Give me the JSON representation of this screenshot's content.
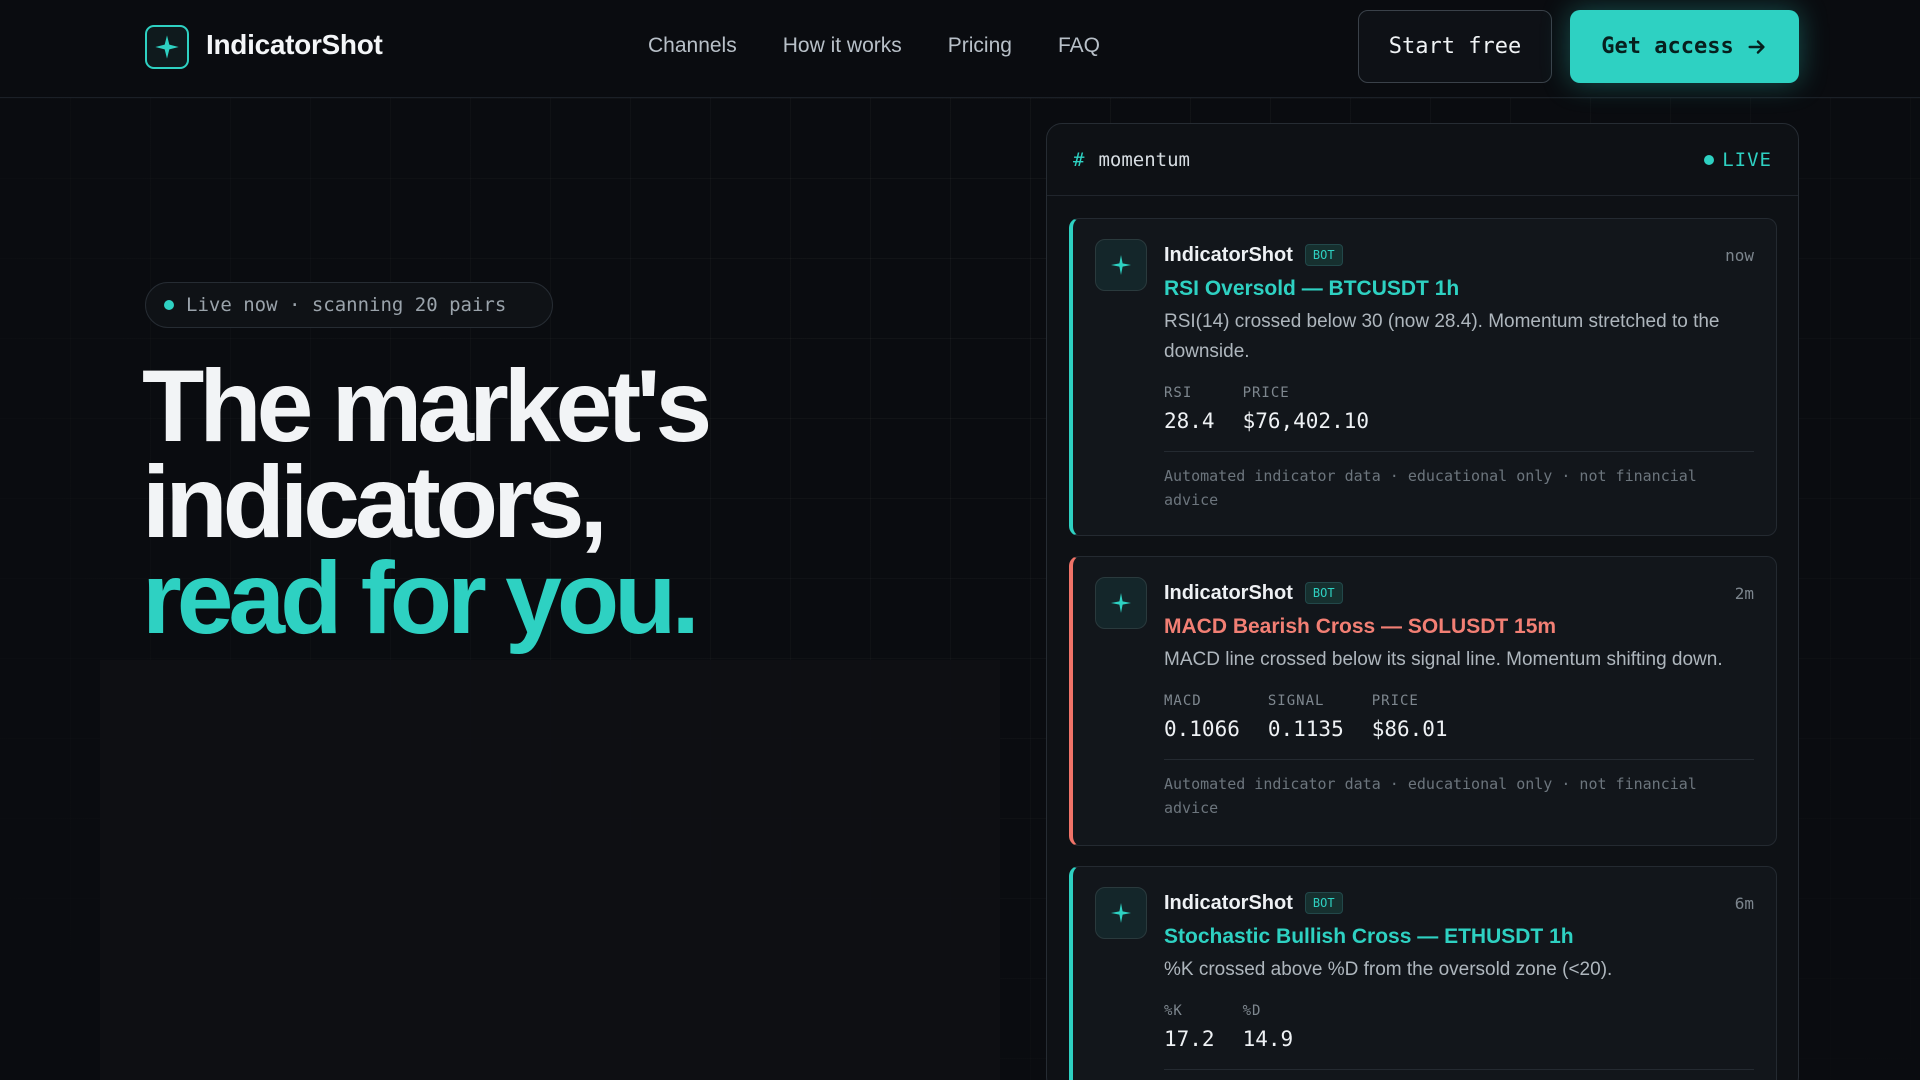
{
  "brand": {
    "name": "IndicatorShot"
  },
  "nav": {
    "items": [
      "Channels",
      "How it works",
      "Pricing",
      "FAQ"
    ]
  },
  "actions": {
    "start_label": "Start free",
    "access_label": "Get access",
    "access_icon": "arrow-right-icon"
  },
  "hero": {
    "pill": "Live now · scanning 20 pairs",
    "line1": "The market's",
    "line2": "indicators,",
    "line3": "read for you."
  },
  "panel": {
    "channel": "momentum",
    "hash": "#",
    "live": "LIVE",
    "messages": [
      {
        "author": "IndicatorShot",
        "badge": "BOT",
        "time": "now",
        "title": "RSI Oversold — BTCUSDT 1h",
        "desc": "RSI(14) crossed below 30 (now 28.4). Momentum stretched to the downside.",
        "metrics": [
          {
            "label": "RSI",
            "value": "28.4"
          },
          {
            "label": "PRICE",
            "value": "$76,402.10"
          }
        ],
        "disclaimer": "Automated indicator data · educational only · not financial advice",
        "accent": "#2ed1c2"
      },
      {
        "author": "IndicatorShot",
        "badge": "BOT",
        "time": "2m",
        "title": "MACD Bearish Cross — SOLUSDT 15m",
        "desc": "MACD line crossed below its signal line. Momentum shifting down.",
        "metrics": [
          {
            "label": "MACD",
            "value": "0.1066"
          },
          {
            "label": "SIGNAL",
            "value": "0.1135"
          },
          {
            "label": "PRICE",
            "value": "$86.01"
          }
        ],
        "disclaimer": "Automated indicator data · educational only · not financial advice",
        "accent": "#f07368"
      },
      {
        "author": "IndicatorShot",
        "badge": "BOT",
        "time": "6m",
        "title": "Stochastic Bullish Cross — ETHUSDT 1h",
        "desc": "%K crossed above %D from the oversold zone (<20).",
        "metrics": [
          {
            "label": "%K",
            "value": "17.2"
          },
          {
            "label": "%D",
            "value": "14.9"
          }
        ],
        "accent": "#2ed1c2"
      }
    ]
  },
  "colors": {
    "accent": "#2ed1c2",
    "bearish": "#f07368",
    "background": "#0a0c10"
  }
}
